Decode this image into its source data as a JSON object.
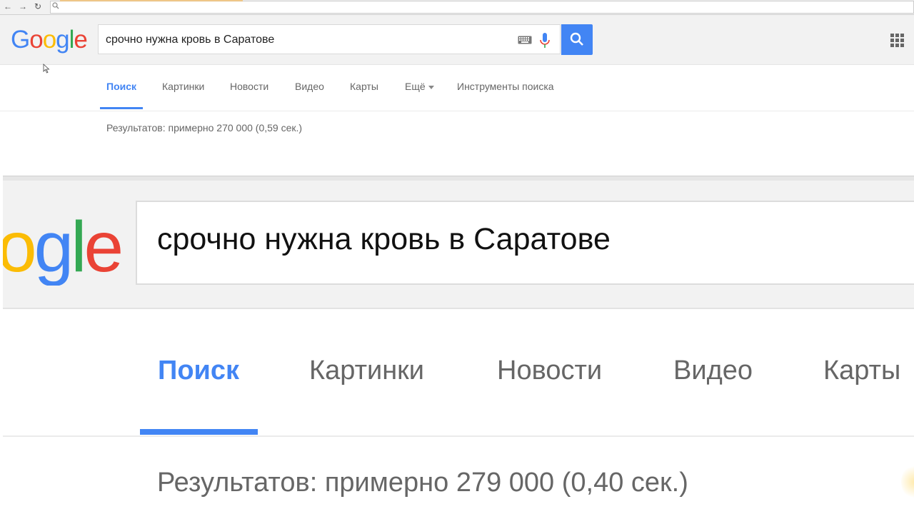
{
  "query": "срочно нужна кровь в Саратове",
  "logo": {
    "letters": [
      "G",
      "o",
      "o",
      "g",
      "l",
      "e"
    ],
    "colors": [
      "#4285f4",
      "#ea4335",
      "#fbbc05",
      "#4285f4",
      "#34a853",
      "#ea4335"
    ]
  },
  "logo_zoom": {
    "letters": [
      "o",
      "g",
      "l",
      "e"
    ],
    "colors": [
      "#fbbc05",
      "#4285f4",
      "#34a853",
      "#ea4335"
    ]
  },
  "tabs": {
    "search": "Поиск",
    "images": "Картинки",
    "news": "Новости",
    "video": "Видео",
    "maps": "Карты",
    "more": "Ещё",
    "tools": "Инструменты поиска"
  },
  "results_small": "Результатов: примерно 270 000 (0,59 сек.)",
  "results_big": "Результатов: примерно 279 000 (0,40 сек.)",
  "colors": {
    "accent": "#4285f4",
    "header_bg": "#f2f2f2"
  },
  "icons": [
    "back-icon",
    "forward-icon",
    "reload-icon",
    "search-icon",
    "keyboard-icon",
    "mic-icon",
    "apps-grid-icon",
    "cursor-icon"
  ]
}
